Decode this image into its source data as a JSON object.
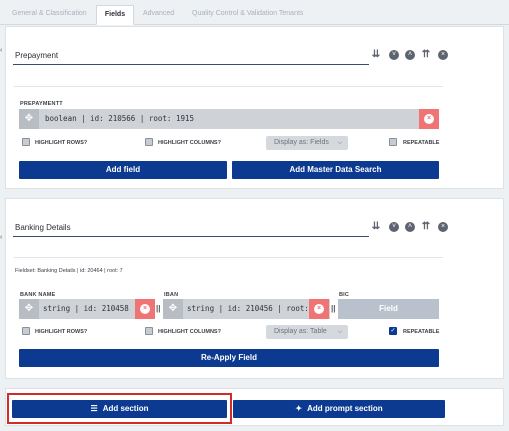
{
  "tabs": [
    {
      "label": "General & Classification"
    },
    {
      "label": "Fields"
    },
    {
      "label": "Advanced"
    },
    {
      "label": "Quality Control & Validation Tenants"
    }
  ],
  "section1": {
    "title": "Prepayment",
    "field_label": "PREPAYMENTT",
    "field_text": "boolean | id: 210566 | root: 1915",
    "highlight_rows": "HIGHLIGHT ROWS?",
    "highlight_columns": "HIGHLIGHT COLUMNS?",
    "display_as": "Display as: Fields",
    "repeatable": "REPEATABLE",
    "add_field": "Add field",
    "add_master": "Add Master Data Search"
  },
  "section2": {
    "title": "Banking Details",
    "fieldset_meta": "Fieldset: Banking Details | id: 20464 | root: 7",
    "col1_label": "BANK NAME",
    "col1_text": "string | id: 210458",
    "col2_label": "IBAN",
    "col2_text": "string | id: 210456 | root:",
    "col3_label": "BIC",
    "col3_button": "Field",
    "sep": "||",
    "highlight_rows": "HIGHLIGHT ROWS?",
    "highlight_columns": "HIGHLIGHT COLUMNS?",
    "display_as": "Display as: Table",
    "repeatable": "REPEATABLE",
    "reapply": "Re-Apply Field"
  },
  "footer": {
    "add_section": "Add section",
    "add_prompt": "Add prompt section"
  },
  "icons": {
    "drag": "move-icon",
    "delete": "close-circle-icon",
    "collapse_all": "double-chevron-down-icon",
    "down": "chevron-down-circle-icon",
    "up": "chevron-up-circle-icon",
    "expand_all": "double-chevron-up-icon",
    "remove": "close-circle-icon"
  },
  "colors": {
    "primary": "#0d3a91",
    "danger": "#f07474",
    "highlight": "#d32a2a"
  }
}
